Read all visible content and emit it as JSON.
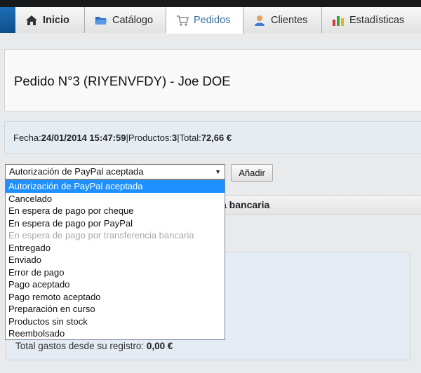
{
  "tabs": [
    {
      "label": "Inicio",
      "icon": "home-icon",
      "active": false
    },
    {
      "label": "Catálogo",
      "icon": "folder-icon",
      "active": false
    },
    {
      "label": "Pedidos",
      "icon": "cart-icon",
      "active": true
    },
    {
      "label": "Clientes",
      "icon": "user-icon",
      "active": false
    },
    {
      "label": "Estadísticas",
      "icon": "bar-chart-icon",
      "active": false
    }
  ],
  "order": {
    "title": "Pedido N°3 (RIYENVFDY) - Joe DOE",
    "date_label": "Fecha:",
    "date_value": "24/01/2014 15:47:59",
    "products_label": "Productos:",
    "products_value": "3",
    "total_label": "Total:",
    "total_value": "72,66 €",
    "separator": "|"
  },
  "status": {
    "selected": "Autorización de PayPal aceptada",
    "add_button": "Añadir",
    "options": [
      {
        "label": "Autorización de PayPal aceptada",
        "state": "selected"
      },
      {
        "label": "Cancelado",
        "state": "normal"
      },
      {
        "label": "En espera de pago por cheque",
        "state": "normal"
      },
      {
        "label": "En espera de pago por PayPal",
        "state": "normal"
      },
      {
        "label": "En espera de pago por transferencia bancaria",
        "state": "disabled"
      },
      {
        "label": "Entregado",
        "state": "normal"
      },
      {
        "label": "Enviado",
        "state": "normal"
      },
      {
        "label": "Error de pago",
        "state": "normal"
      },
      {
        "label": "Pago aceptado",
        "state": "normal"
      },
      {
        "label": "Pago remoto aceptado",
        "state": "normal"
      },
      {
        "label": "Preparación en curso",
        "state": "normal"
      },
      {
        "label": "Productos sin stock",
        "state": "normal"
      },
      {
        "label": "Reembolsado",
        "state": "normal"
      }
    ]
  },
  "payment": {
    "header_visible_fragment": "a bancaria"
  },
  "customer": {
    "total_spent_label": "Total gastos desde su registro:",
    "total_spent_value": "0,00 €"
  },
  "colors": {
    "accent_blue": "#1e90ff",
    "tab_active_text": "#3a6f9a",
    "info_bar_bg": "#e5ecf2"
  }
}
